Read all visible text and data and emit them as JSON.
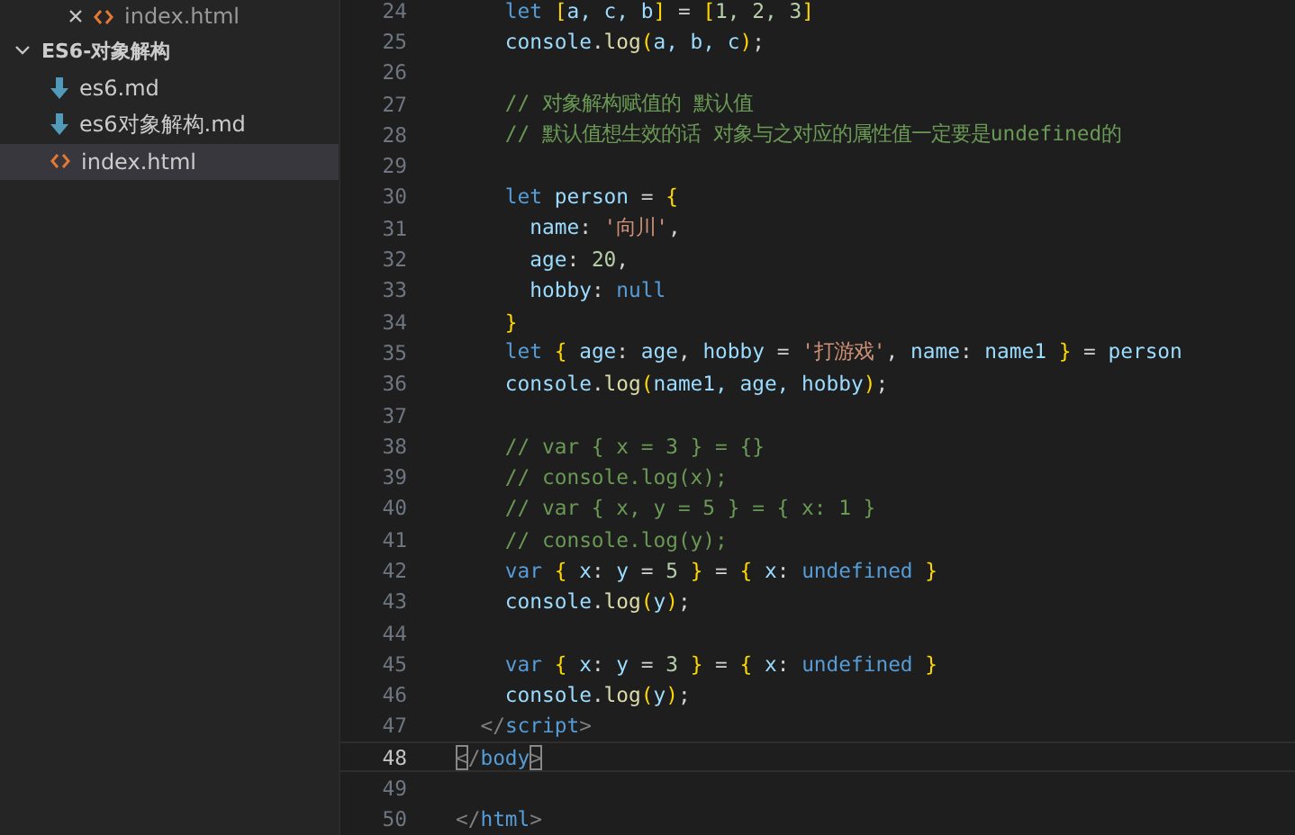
{
  "sidebar": {
    "open_editor": {
      "label": "index.html"
    },
    "folder": {
      "label": "ES6-对象解构",
      "expanded": true
    },
    "files": [
      {
        "label": "es6.md",
        "kind": "markdown",
        "selected": false
      },
      {
        "label": "es6对象解构.md",
        "kind": "markdown",
        "selected": false
      },
      {
        "label": "index.html",
        "kind": "html",
        "selected": true
      }
    ]
  },
  "editor": {
    "lines": [
      {
        "number": "24",
        "current": false,
        "tokens": [
          {
            "kind": "keyword",
            "text": "    let "
          },
          {
            "kind": "bracket",
            "text": "["
          },
          {
            "kind": "variable",
            "text": "a, c, b"
          },
          {
            "kind": "bracket",
            "text": "]"
          },
          {
            "kind": "plain",
            "text": " = "
          },
          {
            "kind": "bracket",
            "text": "["
          },
          {
            "kind": "number",
            "text": "1, 2, 3"
          },
          {
            "kind": "bracket",
            "text": "]"
          }
        ]
      },
      {
        "number": "25",
        "current": false,
        "tokens": [
          {
            "kind": "variable",
            "text": "    console"
          },
          {
            "kind": "plain",
            "text": "."
          },
          {
            "kind": "function",
            "text": "log"
          },
          {
            "kind": "bracket",
            "text": "("
          },
          {
            "kind": "variable",
            "text": "a, b, c"
          },
          {
            "kind": "bracket",
            "text": ")"
          },
          {
            "kind": "plain",
            "text": ";"
          }
        ]
      },
      {
        "number": "26",
        "current": false
      },
      {
        "number": "27",
        "current": false,
        "tokens": [
          {
            "kind": "comment",
            "text": "    // 对象解构赋值的 默认值"
          }
        ]
      },
      {
        "number": "28",
        "current": false,
        "tokens": [
          {
            "kind": "comment",
            "text": "    // 默认值想生效的话 对象与之对应的属性值一定要是undefined的"
          }
        ]
      },
      {
        "number": "29",
        "current": false
      },
      {
        "number": "30",
        "current": false,
        "tokens": [
          {
            "kind": "keyword",
            "text": "    let"
          },
          {
            "kind": "variable",
            "text": " person"
          },
          {
            "kind": "plain",
            "text": " = "
          },
          {
            "kind": "bracket",
            "text": "{"
          }
        ]
      },
      {
        "number": "31",
        "current": false,
        "tokens": [
          {
            "kind": "variable",
            "text": "      name"
          },
          {
            "kind": "plain",
            "text": ": "
          },
          {
            "kind": "string",
            "text": "'向川'"
          },
          {
            "kind": "plain",
            "text": ","
          }
        ]
      },
      {
        "number": "32",
        "current": false,
        "tokens": [
          {
            "kind": "variable",
            "text": "      age"
          },
          {
            "kind": "plain",
            "text": ": "
          },
          {
            "kind": "number",
            "text": "20"
          },
          {
            "kind": "plain",
            "text": ","
          }
        ]
      },
      {
        "number": "33",
        "current": false,
        "tokens": [
          {
            "kind": "variable",
            "text": "      hobby"
          },
          {
            "kind": "plain",
            "text": ": "
          },
          {
            "kind": "constant",
            "text": "null"
          }
        ]
      },
      {
        "number": "34",
        "current": false,
        "tokens": [
          {
            "kind": "bracket",
            "text": "    }"
          }
        ]
      },
      {
        "number": "35",
        "current": false,
        "tokens": [
          {
            "kind": "keyword",
            "text": "    let "
          },
          {
            "kind": "bracket",
            "text": "{"
          },
          {
            "kind": "variable",
            "text": " age"
          },
          {
            "kind": "plain",
            "text": ": "
          },
          {
            "kind": "variable",
            "text": "age"
          },
          {
            "kind": "plain",
            "text": ", "
          },
          {
            "kind": "variable",
            "text": "hobby"
          },
          {
            "kind": "plain",
            "text": " = "
          },
          {
            "kind": "string",
            "text": "'打游戏'"
          },
          {
            "kind": "plain",
            "text": ", "
          },
          {
            "kind": "variable",
            "text": "name"
          },
          {
            "kind": "plain",
            "text": ": "
          },
          {
            "kind": "variable",
            "text": "name1 "
          },
          {
            "kind": "bracket",
            "text": "}"
          },
          {
            "kind": "plain",
            "text": " = "
          },
          {
            "kind": "variable",
            "text": "person"
          }
        ]
      },
      {
        "number": "36",
        "current": false,
        "tokens": [
          {
            "kind": "variable",
            "text": "    console"
          },
          {
            "kind": "plain",
            "text": "."
          },
          {
            "kind": "function",
            "text": "log"
          },
          {
            "kind": "bracket",
            "text": "("
          },
          {
            "kind": "variable",
            "text": "name1, age, hobby"
          },
          {
            "kind": "bracket",
            "text": ")"
          },
          {
            "kind": "plain",
            "text": ";"
          }
        ]
      },
      {
        "number": "37",
        "current": false
      },
      {
        "number": "38",
        "current": false,
        "tokens": [
          {
            "kind": "comment",
            "text": "    // var { x = 3 } = {}"
          }
        ]
      },
      {
        "number": "39",
        "current": false,
        "tokens": [
          {
            "kind": "comment",
            "text": "    // console.log(x);"
          }
        ]
      },
      {
        "number": "40",
        "current": false,
        "tokens": [
          {
            "kind": "comment",
            "text": "    // var { x, y = 5 } = { x: 1 }"
          }
        ]
      },
      {
        "number": "41",
        "current": false,
        "tokens": [
          {
            "kind": "comment",
            "text": "    // console.log(y);"
          }
        ]
      },
      {
        "number": "42",
        "current": false,
        "tokens": [
          {
            "kind": "keyword",
            "text": "    var "
          },
          {
            "kind": "bracket",
            "text": "{"
          },
          {
            "kind": "variable",
            "text": " x"
          },
          {
            "kind": "plain",
            "text": ": "
          },
          {
            "kind": "variable",
            "text": "y"
          },
          {
            "kind": "plain",
            "text": " = "
          },
          {
            "kind": "number",
            "text": "5 "
          },
          {
            "kind": "bracket",
            "text": "}"
          },
          {
            "kind": "plain",
            "text": " = "
          },
          {
            "kind": "bracket",
            "text": "{"
          },
          {
            "kind": "variable",
            "text": " x"
          },
          {
            "kind": "plain",
            "text": ": "
          },
          {
            "kind": "constant",
            "text": "undefined "
          },
          {
            "kind": "bracket",
            "text": "}"
          }
        ]
      },
      {
        "number": "43",
        "current": false,
        "tokens": [
          {
            "kind": "variable",
            "text": "    console"
          },
          {
            "kind": "plain",
            "text": "."
          },
          {
            "kind": "function",
            "text": "log"
          },
          {
            "kind": "bracket",
            "text": "("
          },
          {
            "kind": "variable",
            "text": "y"
          },
          {
            "kind": "bracket",
            "text": ")"
          },
          {
            "kind": "plain",
            "text": ";"
          }
        ]
      },
      {
        "number": "44",
        "current": false
      },
      {
        "number": "45",
        "current": false,
        "tokens": [
          {
            "kind": "keyword",
            "text": "    var "
          },
          {
            "kind": "bracket",
            "text": "{"
          },
          {
            "kind": "variable",
            "text": " x"
          },
          {
            "kind": "plain",
            "text": ": "
          },
          {
            "kind": "variable",
            "text": "y"
          },
          {
            "kind": "plain",
            "text": " = "
          },
          {
            "kind": "number",
            "text": "3 "
          },
          {
            "kind": "bracket",
            "text": "}"
          },
          {
            "kind": "plain",
            "text": " = "
          },
          {
            "kind": "bracket",
            "text": "{"
          },
          {
            "kind": "variable",
            "text": " x"
          },
          {
            "kind": "plain",
            "text": ": "
          },
          {
            "kind": "constant",
            "text": "undefined "
          },
          {
            "kind": "bracket",
            "text": "}"
          }
        ]
      },
      {
        "number": "46",
        "current": false,
        "tokens": [
          {
            "kind": "variable",
            "text": "    console"
          },
          {
            "kind": "plain",
            "text": "."
          },
          {
            "kind": "function",
            "text": "log"
          },
          {
            "kind": "bracket",
            "text": "("
          },
          {
            "kind": "variable",
            "text": "y"
          },
          {
            "kind": "bracket",
            "text": ")"
          },
          {
            "kind": "plain",
            "text": ";"
          }
        ]
      },
      {
        "number": "47",
        "current": false,
        "tokens": [
          {
            "kind": "tag",
            "text": "  </"
          },
          {
            "kind": "tagname",
            "text": "script"
          },
          {
            "kind": "tag",
            "text": ">"
          }
        ]
      },
      {
        "number": "48",
        "current": true,
        "tokens": [
          {
            "kind": "match",
            "text": "<"
          },
          {
            "kind": "tag",
            "text": "/"
          },
          {
            "kind": "tagname",
            "text": "body"
          },
          {
            "kind": "match",
            "text": ">"
          }
        ]
      },
      {
        "number": "49",
        "current": false
      },
      {
        "number": "50",
        "current": false,
        "tokens": [
          {
            "kind": "tag",
            "text": "</"
          },
          {
            "kind": "tagname",
            "text": "html"
          },
          {
            "kind": "tag",
            "text": ">"
          }
        ]
      }
    ]
  }
}
